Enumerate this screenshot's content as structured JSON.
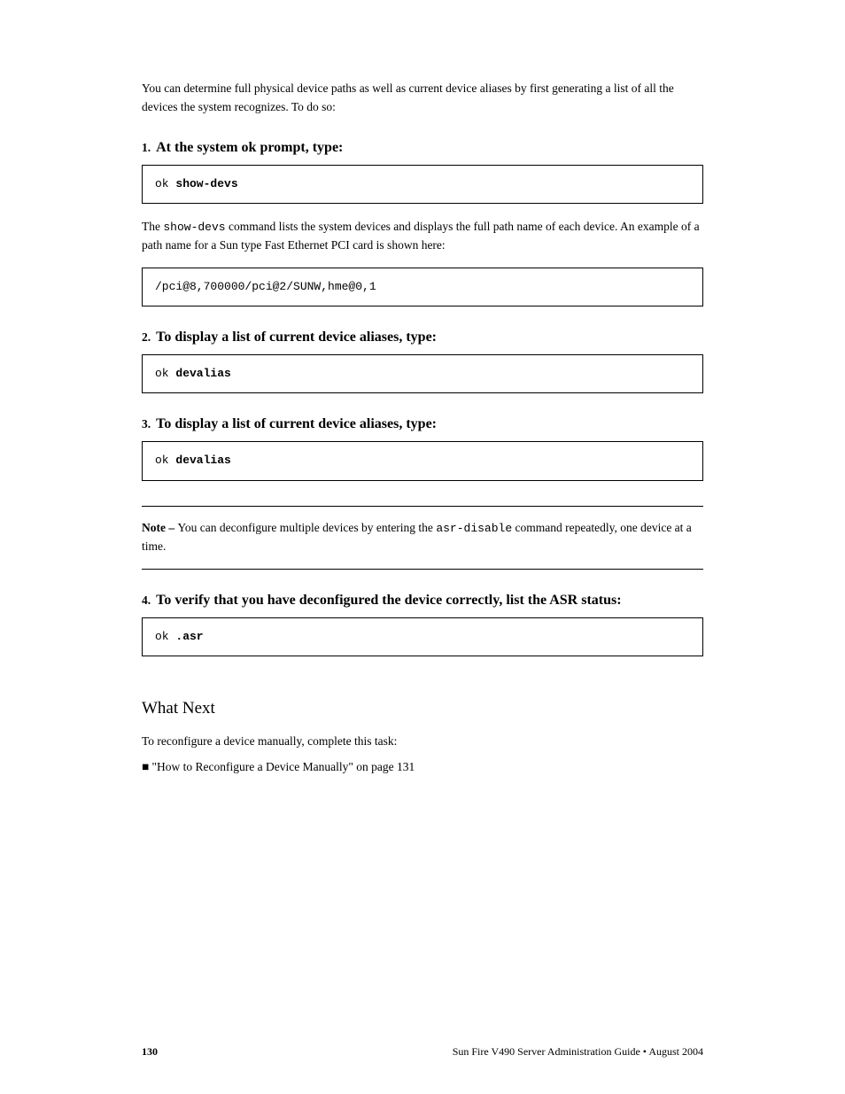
{
  "intro_para": "You can determine full physical device paths as well as current device aliases by first generating a list of all the devices the system recognizes. To do so:",
  "step1": {
    "num": "1.",
    "text": "At the system ok prompt, type:"
  },
  "code1_prompt": "ok ",
  "code1_cmd": "show-devs",
  "para2_a": "The ",
  "para2_b": "show-devs",
  "para2_c": " command lists the system devices and displays the full path name of each device. An example of a path name for a Sun type Fast Ethernet PCI card is shown here:",
  "code2": "/pci@8,700000/pci@2/SUNW,hme@0,1",
  "step2": {
    "num": "2.",
    "text": "To display a list of current device aliases, type:"
  },
  "code3_prompt": "ok ",
  "code3_cmd": "devalias",
  "step3": {
    "num": "3.",
    "text": "To display a list of current device aliases, type:"
  },
  "code4_prompt": "ok ",
  "code4_cmd": "devalias",
  "note": {
    "label": "Note – ",
    "body_a": "You can deconfigure multiple devices by entering the ",
    "body_b": "asr-disable",
    "body_c": " command repeatedly, one device at a time."
  },
  "step4": {
    "num": "4.",
    "text": "To verify that you have deconfigured the device correctly, list the ASR status:"
  },
  "code5_prompt": "ok ",
  "code5_cmd": ".asr",
  "heading2": "What Next",
  "next_body": "To reconfigure a device manually, complete this task:",
  "bullet": "■ ",
  "bullet_text": "\"How to Reconfigure a Device Manually\" on page 131",
  "footer_left": "130",
  "footer_right": "Sun Fire V490 Server Administration Guide • August 2004"
}
